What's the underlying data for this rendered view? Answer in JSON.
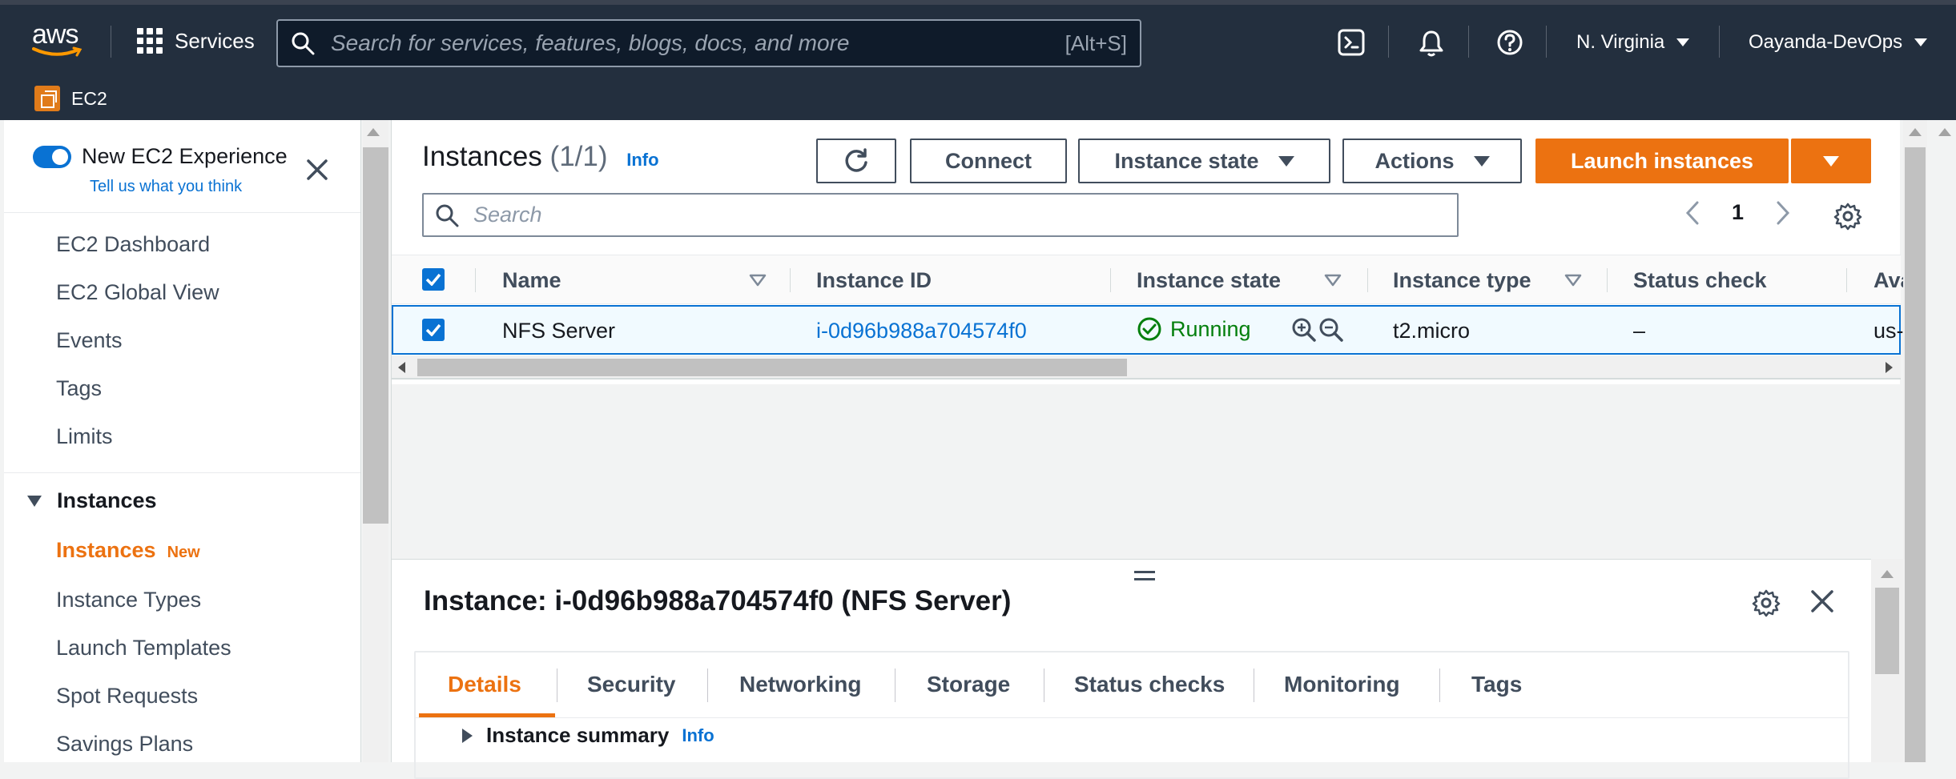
{
  "topbar": {
    "logo_text": "aws",
    "services_label": "Services",
    "search_placeholder": "Search for services, features, blogs, docs, and more",
    "search_shortcut": "[Alt+S]",
    "region_label": "N. Virginia",
    "account_label": "Oayanda-DevOps",
    "service_crumb": "EC2",
    "colors": {
      "bg": "#232f3e",
      "accent": "#ec7211"
    }
  },
  "sidebar": {
    "experience_title": "New EC2 Experience",
    "experience_link": "Tell us what you think",
    "items_top": [
      "EC2 Dashboard",
      "EC2 Global View",
      "Events",
      "Tags",
      "Limits"
    ],
    "section_label": "Instances",
    "active_item": "Instances",
    "active_badge": "New",
    "items_instances": [
      "Instance Types",
      "Launch Templates",
      "Spot Requests",
      "Savings Plans"
    ]
  },
  "main": {
    "title": "Instances",
    "count": "(1/1)",
    "info_label": "Info",
    "buttons": {
      "connect": "Connect",
      "instance_state": "Instance state",
      "actions": "Actions",
      "launch": "Launch instances"
    },
    "filter_placeholder": "Search",
    "page_number": "1",
    "columns": [
      "Name",
      "Instance ID",
      "Instance state",
      "Instance type",
      "Status check",
      "Ava"
    ],
    "row": {
      "name": "NFS Server",
      "instance_id": "i-0d96b988a704574f0",
      "state": "Running",
      "type": "t2.micro",
      "status_check": "–",
      "availability_zone": "us-"
    }
  },
  "details": {
    "title": "Instance: i-0d96b988a704574f0 (NFS Server)",
    "tabs": [
      "Details",
      "Security",
      "Networking",
      "Storage",
      "Status checks",
      "Monitoring",
      "Tags"
    ],
    "active_tab": "Details",
    "summary_label": "Instance summary",
    "summary_info": "Info"
  },
  "icons": [
    "grid-icon",
    "search-icon",
    "cloudshell-icon",
    "bell-icon",
    "help-icon",
    "caret-down-icon",
    "close-icon",
    "refresh-icon",
    "settings-gear-icon",
    "chevron-left-icon",
    "chevron-right-icon",
    "sort-icon",
    "check-icon",
    "running-check-icon",
    "zoom-in-icon",
    "zoom-out-icon",
    "expand-triangle-icon"
  ]
}
